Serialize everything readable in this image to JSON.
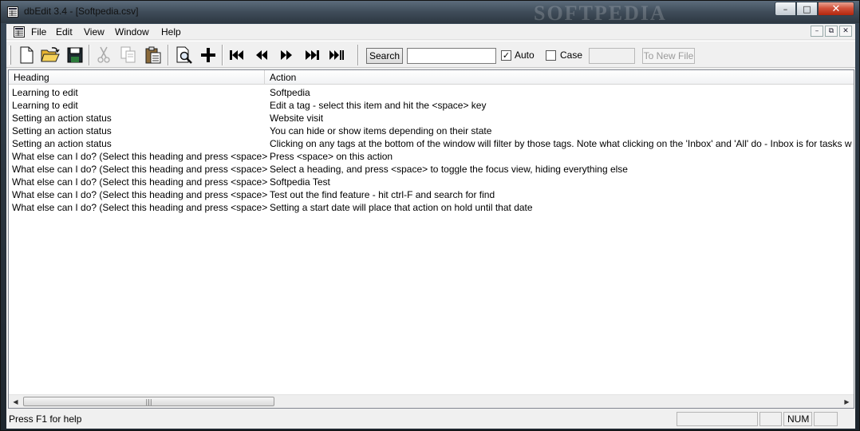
{
  "window": {
    "title": "dbEdit 3.4 - [Softpedia.csv]",
    "watermark": "SOFTPEDIA",
    "controls": {
      "minimize": "–",
      "maximize": "□",
      "close": "✕"
    }
  },
  "menu": {
    "items": [
      "File",
      "Edit",
      "View",
      "Window",
      "Help"
    ],
    "mdi": {
      "minimize": "–",
      "restore": "⧉",
      "close": "✕"
    }
  },
  "toolbar": {
    "icons": [
      "new-file-icon",
      "open-folder-icon",
      "save-icon",
      "cut-icon",
      "copy-icon",
      "paste-icon",
      "print-preview-icon",
      "add-icon",
      "first-record-icon",
      "previous-record-icon",
      "next-record-icon",
      "next-page-icon",
      "last-record-icon"
    ],
    "search_label": "Search",
    "search_value": "",
    "auto_label": "Auto",
    "auto_checked": true,
    "case_label": "Case",
    "case_checked": false,
    "to_new_file_label": "To New File"
  },
  "list": {
    "columns": [
      "Heading",
      "Action"
    ],
    "rows": [
      [
        "Learning to edit",
        "Softpedia"
      ],
      [
        "Learning to edit",
        "Edit a tag - select this item and hit the <space> key"
      ],
      [
        "Setting an action status",
        "Website visit"
      ],
      [
        "Setting an action status",
        "You can hide or show items depending on their state"
      ],
      [
        "Setting an action status",
        "Clicking on any tags at the bottom of the window will filter by those tags.  Note what clicking on the 'Inbox' and 'All' do - Inbox is for tasks w"
      ],
      [
        "What else can I do? (Select this heading and press <space>)",
        "Press <space> on this action"
      ],
      [
        "What else can I do? (Select this heading and press <space>)",
        "Select a heading, and press <space> to toggle the focus view, hiding everything else"
      ],
      [
        "What else can I do? (Select this heading and press <space>)",
        "Softpedia Test"
      ],
      [
        "What else can I do? (Select this heading and press <space>)",
        "Test out the find feature - hit ctrl-F and search for find"
      ],
      [
        "What else can I do? (Select this heading and press <space>)",
        "Setting a start date will place that action on hold until that date"
      ]
    ],
    "scroll": {
      "left": "◀",
      "right": "▶",
      "thumb_grip": "|||"
    }
  },
  "status": {
    "text": "Press F1 for help",
    "num": "NUM"
  }
}
